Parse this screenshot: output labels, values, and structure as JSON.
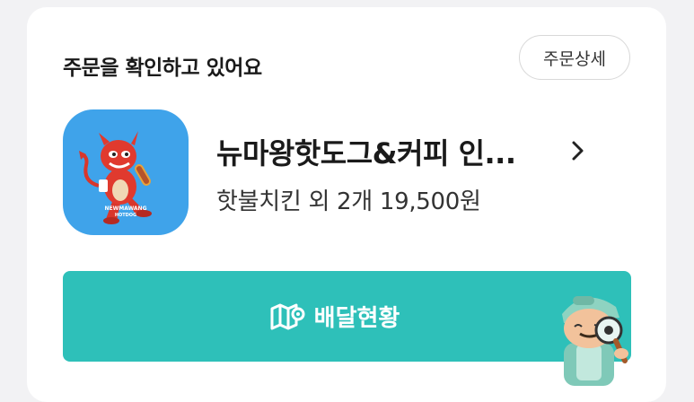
{
  "header": {
    "title": "주문을 확인하고 있어요",
    "detail_button_label": "주문상세"
  },
  "store": {
    "name": "뉴마왕핫도그&커피 인...",
    "logo_text": "NEWMAWANG HOTDOG",
    "order_summary": "핫불치킨 외 2개 19,500원"
  },
  "delivery": {
    "button_label": "배달현황"
  },
  "colors": {
    "accent": "#2ec0b9",
    "logo_bg": "#3fa3ea"
  }
}
